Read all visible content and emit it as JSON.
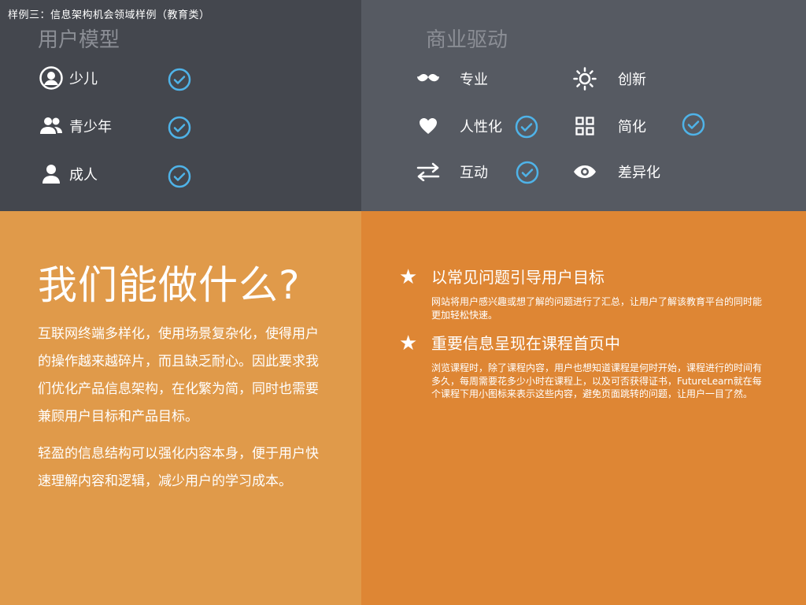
{
  "caption": "样例三：信息架构机会领域样例（教育类）",
  "user_model": {
    "title": "用户模型",
    "items": [
      {
        "label": "少儿",
        "icon": "user-circle-icon",
        "checked": true
      },
      {
        "label": "青少年",
        "icon": "users-icon",
        "checked": true
      },
      {
        "label": "成人",
        "icon": "user-icon",
        "checked": true
      }
    ]
  },
  "business": {
    "title": "商业驱动",
    "items": [
      {
        "label": "专业",
        "icon": "mustache-icon",
        "checked": false
      },
      {
        "label": "创新",
        "icon": "sun-icon",
        "checked": false
      },
      {
        "label": "人性化",
        "icon": "heart-icon",
        "checked": true
      },
      {
        "label": "简化",
        "icon": "grid-icon",
        "checked": true
      },
      {
        "label": "互动",
        "icon": "exchange-icon",
        "checked": true
      },
      {
        "label": "差异化",
        "icon": "eye-icon",
        "checked": false
      }
    ]
  },
  "what_we_do": {
    "title": "我们能做什么?",
    "para1": "互联网终端多样化，使用场景复杂化，使得用户的操作越来越碎片，而且缺乏耐心。因此要求我们优化产品信息架构，在化繁为简，同时也需要兼顾用户目标和产品目标。",
    "para2": "轻盈的信息结构可以强化内容本身，便于用户快速理解内容和逻辑，减少用户的学习成本。"
  },
  "features": [
    {
      "title": "以常见问题引导用户目标",
      "desc": "网站将用户感兴趣或想了解的问题进行了汇总，让用户了解该教育平台的同时能更加轻松快速。"
    },
    {
      "title": "重要信息呈现在课程首页中",
      "desc": "浏览课程时，除了课程内容，用户也想知道课程是何时开始，课程进行的时间有多久，每周需要花多少小时在课程上，以及可否获得证书，FutureLearn就在每个课程下用小图标来表示这些内容，避免页面跳转的问题，让用户一目了然。"
    }
  ],
  "colors": {
    "top_left": "#44474e",
    "top_right": "#565a62",
    "bottom_left": "#e09a4a",
    "bottom_right": "#de8634",
    "check": "#4fb3e8"
  }
}
